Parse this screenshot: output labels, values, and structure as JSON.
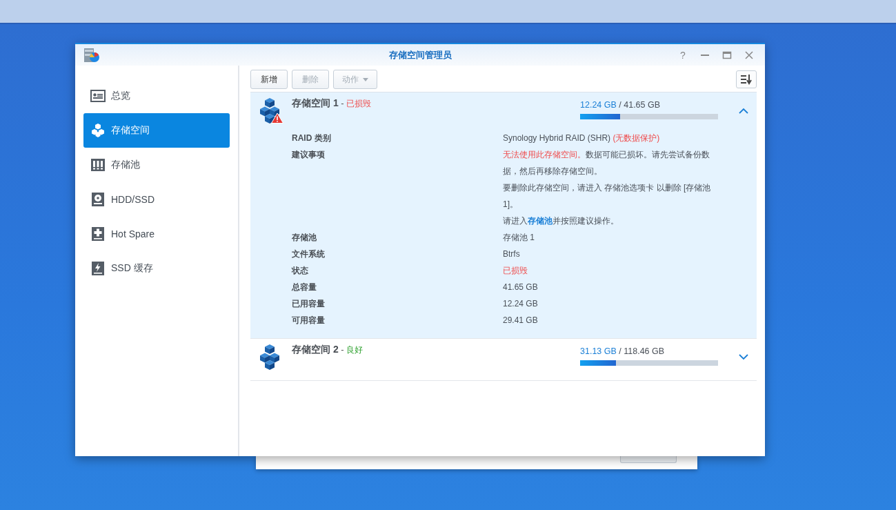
{
  "window": {
    "title": "存储空间管理员",
    "help": "?"
  },
  "sidebar": {
    "items": [
      {
        "label": "总览",
        "kind": "overview",
        "selected": false
      },
      {
        "label": "存储空间",
        "kind": "volume",
        "selected": true
      },
      {
        "label": "存储池",
        "kind": "pool",
        "selected": false
      },
      {
        "label": "HDD/SSD",
        "kind": "disk",
        "selected": false
      },
      {
        "label": "Hot Spare",
        "kind": "spare",
        "selected": false
      },
      {
        "label": "SSD 缓存",
        "kind": "cache",
        "selected": false
      }
    ]
  },
  "toolbar": {
    "buttons": [
      {
        "label": "新增",
        "disabled": false,
        "dropdown": false
      },
      {
        "label": "删除",
        "disabled": true,
        "dropdown": false
      },
      {
        "label": "动作",
        "disabled": true,
        "dropdown": true
      }
    ]
  },
  "volumes": [
    {
      "name": "存储空间 1",
      "separator": "-",
      "status": "已损毁",
      "kind": "damaged",
      "used": "12.24 GB",
      "total": "/ 41.65 GB",
      "level": 0.29,
      "expanded": true,
      "details": [
        {
          "label": "RAID 类别",
          "paragraphs": [
            [
              {
                "text": "Synology Hybrid RAID (SHR) ",
                "kind": "normal"
              },
              {
                "text": "(无数据保护)",
                "kind": "error"
              }
            ]
          ]
        },
        {
          "label": "建议事项",
          "paragraphs": [
            [
              {
                "text": "无法使用此存储空间。",
                "kind": "error"
              },
              {
                "text": "数据可能已损坏。请先尝试备份数据，然后再移除存储空间。",
                "kind": "normal"
              }
            ],
            [
              {
                "text": "要删除此存储空间，请进入 存储池选项卡 以删除 [存储池 1]。",
                "kind": "normal"
              }
            ],
            [
              {
                "text": "请进入",
                "kind": "normal"
              },
              {
                "text": "存储池",
                "kind": "link"
              },
              {
                "text": "并按照建议操作。",
                "kind": "normal"
              }
            ]
          ]
        },
        {
          "label": "存储池",
          "paragraphs": [
            [
              {
                "text": "存储池 1",
                "kind": "normal"
              }
            ]
          ]
        },
        {
          "label": "文件系统",
          "paragraphs": [
            [
              {
                "text": "Btrfs",
                "kind": "normal"
              }
            ]
          ]
        },
        {
          "label": "状态",
          "paragraphs": [
            [
              {
                "text": "已损毁",
                "kind": "error"
              }
            ]
          ]
        },
        {
          "label": "总容量",
          "paragraphs": [
            [
              {
                "text": "41.65 GB",
                "kind": "normal"
              }
            ]
          ]
        },
        {
          "label": "已用容量",
          "paragraphs": [
            [
              {
                "text": "12.24 GB",
                "kind": "normal"
              }
            ]
          ]
        },
        {
          "label": "可用容量",
          "paragraphs": [
            [
              {
                "text": "29.41 GB",
                "kind": "normal"
              }
            ]
          ]
        }
      ]
    },
    {
      "name": "存储空间 2",
      "separator": "-",
      "status": "良好",
      "kind": "good",
      "used": "31.13 GB",
      "total": "/ 118.46 GB",
      "level": 0.26,
      "expanded": false
    }
  ]
}
